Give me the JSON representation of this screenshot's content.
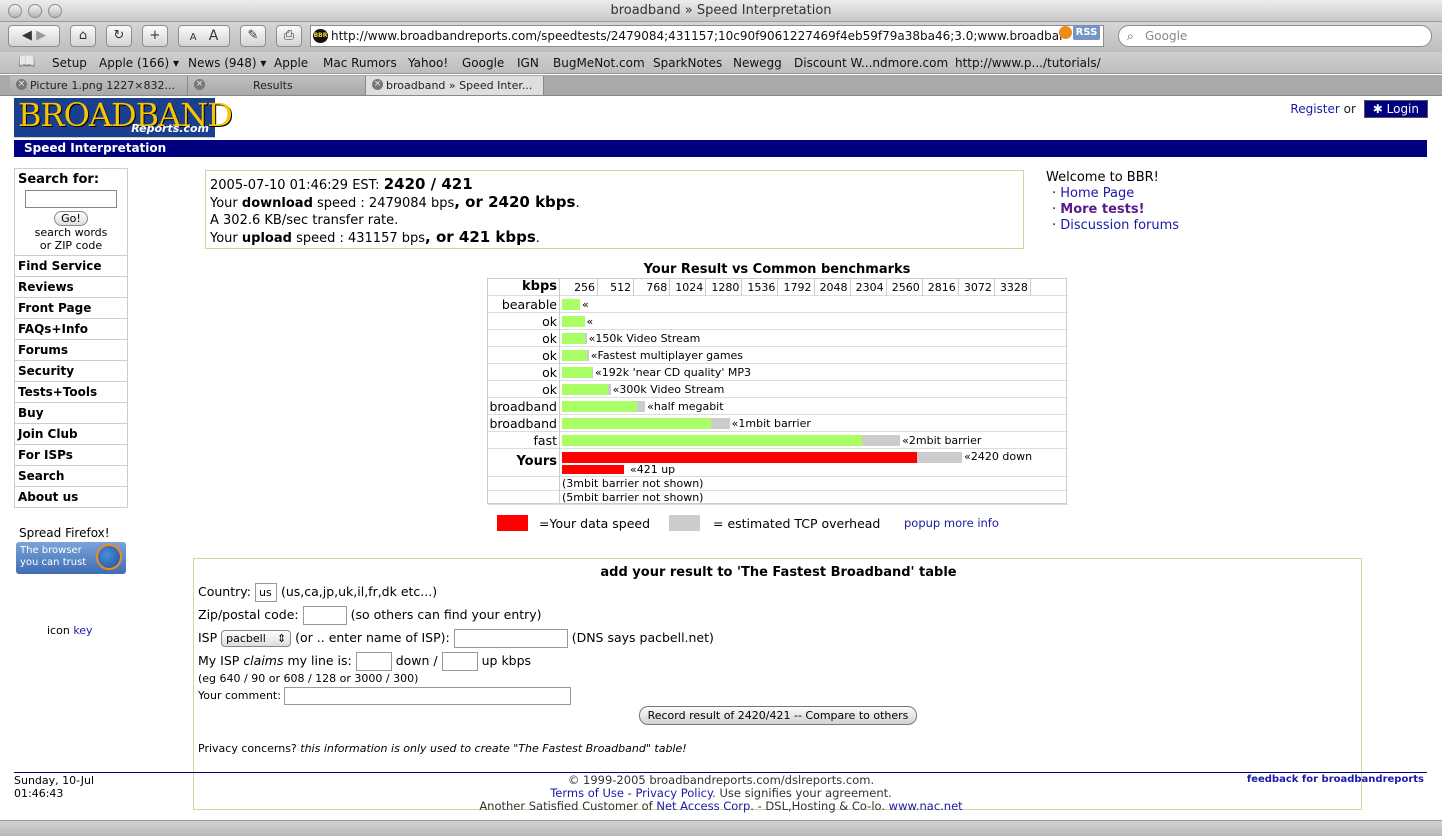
{
  "window": {
    "title": "broadband » Speed Interpretation"
  },
  "toolbar": {
    "url": "http://www.broadbandreports.com/speedtests/2479084;431157;10c90f9061227469f4eb59f79a38ba46;3.0;www.broadbar",
    "rss": "RSS",
    "search_placeholder": "Google",
    "font_small": "A",
    "font_large": "A"
  },
  "bookmarks": [
    "Setup",
    "Apple (166) ▾",
    "News (948) ▾",
    "Apple",
    "Mac Rumors",
    "Yahoo!",
    "Google",
    "IGN",
    "BugMeNot.com",
    "SparkNotes",
    "Newegg",
    "Discount W...ndmore.com",
    "http://www.p.../tutorials/"
  ],
  "tabs": [
    {
      "label": "Picture 1.png 1227×832..."
    },
    {
      "label": "Results"
    },
    {
      "label": "broadband » Speed Inter..."
    }
  ],
  "site": {
    "logo_big": "BROADBAND",
    "logo_small": "Reports.com",
    "section": "Speed Interpretation",
    "register": "Register",
    "or": "or",
    "login": "Login"
  },
  "sidebar": {
    "search_heading": "Search for:",
    "go": "Go!",
    "search_hint_1": "search words",
    "search_hint_2": "or ZIP code",
    "items": [
      "Find Service",
      "Reviews",
      "Front Page",
      "FAQs+Info",
      "Forums",
      "Security",
      "Tests+Tools",
      "Buy",
      "Join Club",
      "For ISPs",
      "Search",
      "About us"
    ],
    "firefox_heading": "Spread Firefox!",
    "firefox_line1": "The browser",
    "firefox_line2": "you can trust",
    "icon_text": "icon",
    "key_link": "key"
  },
  "result": {
    "timestamp": "2005-07-10 01:46:29 EST:",
    "summary": "2420 / 421",
    "line1_a": "Your",
    "line1_b": "download",
    "line1_c": "speed : 2479084 bps",
    "line1_d": ", or 2420 kbps",
    "line1_e": ".",
    "line2": "A 302.6 KB/sec transfer rate.",
    "line3_a": "Your",
    "line3_b": "upload",
    "line3_c": "speed : 431157 bps",
    "line3_d": ", or 421 kbps",
    "line3_e": "."
  },
  "welcome": {
    "heading": "Welcome to BBR!",
    "links": [
      "Home Page",
      "More tests!",
      "Discussion forums"
    ]
  },
  "chart_data": {
    "type": "bar",
    "title": "Your Result vs Common benchmarks",
    "xlabel": "kbps",
    "xticks": [
      256,
      512,
      768,
      1024,
      1280,
      1536,
      1792,
      2048,
      2304,
      2560,
      2816,
      3072,
      3328
    ],
    "xlim": [
      0,
      3584
    ],
    "rows": [
      {
        "label": "bearable",
        "value": 128,
        "overhead": 0,
        "note": "«"
      },
      {
        "label": "ok",
        "value": 160,
        "overhead": 0,
        "note": "«"
      },
      {
        "label": "ok",
        "value": 165,
        "overhead": 10,
        "note": "«150k Video Stream"
      },
      {
        "label": "ok",
        "value": 180,
        "overhead": 10,
        "note": "«Fastest multiplayer games"
      },
      {
        "label": "ok",
        "value": 210,
        "overhead": 10,
        "note": "«192k 'near CD quality' MP3"
      },
      {
        "label": "ok",
        "value": 330,
        "overhead": 15,
        "note": "«300k Video Stream"
      },
      {
        "label": "broadband",
        "value": 530,
        "overhead": 60,
        "note": "«half megabit"
      },
      {
        "label": "broadband",
        "value": 1060,
        "overhead": 130,
        "note": "«1mbit barrier"
      },
      {
        "label": "fast",
        "value": 2130,
        "overhead": 270,
        "note": "«2mbit barrier"
      }
    ],
    "yours": {
      "label": "Yours",
      "down": 2520,
      "down_overhead": 320,
      "down_note": "«2420 down",
      "up": 440,
      "up_overhead": 0,
      "up_note": "«421 up"
    },
    "notes": [
      "(3mbit barrier not shown)",
      "(5mbit barrier not shown)"
    ],
    "colors": {
      "benchmark": "#aaff66",
      "overhead": "#cccccc",
      "yours": "#ff0000"
    }
  },
  "legend": {
    "data": "=Your data speed",
    "overhead": "= estimated TCP overhead",
    "popup": "popup more info"
  },
  "form": {
    "title": "add your result to 'The Fastest Broadband' table",
    "country_label": "Country:",
    "country_value": "us",
    "country_hint": "(us,ca,jp,uk,il,fr,dk etc...)",
    "zip_label": "Zip/postal code:",
    "zip_hint": "(so others can find your entry)",
    "isp_label": "ISP",
    "isp_select": "pacbell",
    "isp_or": "(or .. enter name of ISP):",
    "isp_dns": "(DNS says pacbell.net)",
    "claims_a": "My ISP",
    "claims_b": "claims",
    "claims_c": "my line is:",
    "down": "down /",
    "up": "up kbps",
    "example": "(eg 640 / 90 or 608 / 128 or 3000 / 300)",
    "comment_label": "Your comment:",
    "record_button": "Record result of 2420/421 -- Compare to others",
    "privacy_a": "Privacy concerns?",
    "privacy_b": "this information is only used to create \"The Fastest Broadband\" table!"
  },
  "footer": {
    "date": "Sunday, 10-Jul",
    "time": "01:46:43",
    "copyright": "© 1999-2005 broadbandreports.com/dslreports.com.",
    "terms": "Terms of Use",
    "dash": "-",
    "privacy": "Privacy Policy",
    "agree": ". Use signifies your agreement.",
    "customer_a": "Another Satisfied Customer of",
    "customer_link": "Net Access Corp.",
    "customer_b": "- DSL,Hosting & Co-lo.",
    "nac": "www.nac.net",
    "feedback": "feedback for broadbandreports"
  }
}
